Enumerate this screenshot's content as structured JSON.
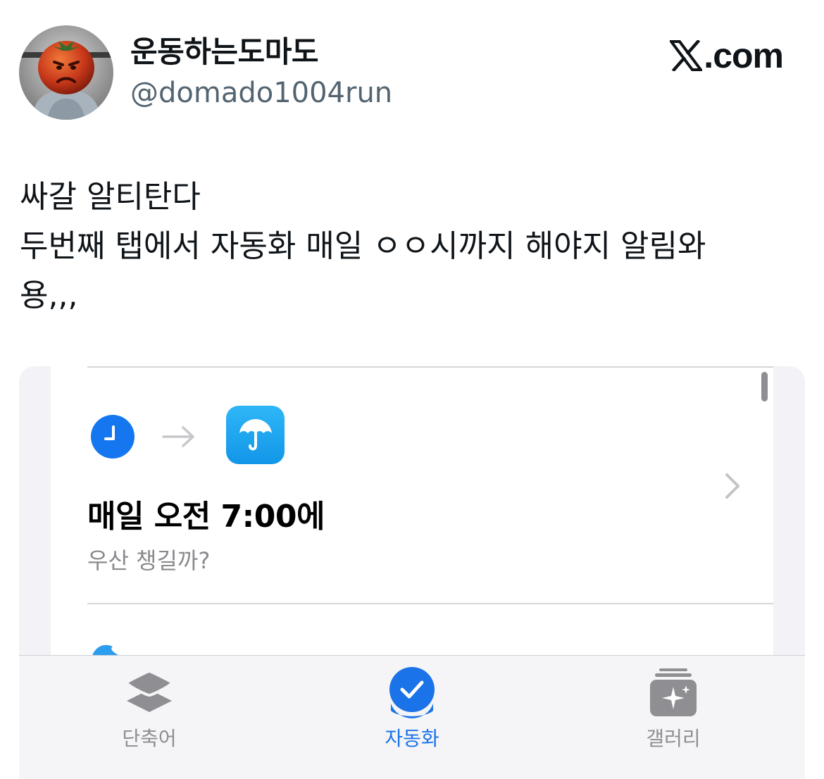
{
  "tweet": {
    "author": {
      "display_name": "운동하는도마도",
      "handle": "@domado1004run"
    },
    "brand": {
      "text": ".com",
      "icon": "x-logo-icon"
    },
    "text_lines": [
      "싸갈 알티탄다",
      "두번째 탭에서 자동화 매일 ㅇㅇ시까지 해야지 알림와",
      "용,,,"
    ]
  },
  "screenshot": {
    "automation": {
      "trigger_icon": "clock-icon",
      "action_icon": "umbrella-icon",
      "title": "매일 오전 7:00에",
      "subtitle": "우산 챙길까?"
    },
    "tabbar": {
      "tabs": [
        {
          "label": "단축어",
          "icon": "layers-icon",
          "selected": false
        },
        {
          "label": "자동화",
          "icon": "checkmark-circle-icon",
          "selected": true
        },
        {
          "label": "갤러리",
          "icon": "gallery-sparkle-icon",
          "selected": false
        }
      ]
    }
  },
  "colors": {
    "accent": "#1a73e8",
    "handle_gray": "#536471",
    "tab_inactive": "#8e8e93",
    "weather_icon_blue": "#1ca7f2"
  }
}
